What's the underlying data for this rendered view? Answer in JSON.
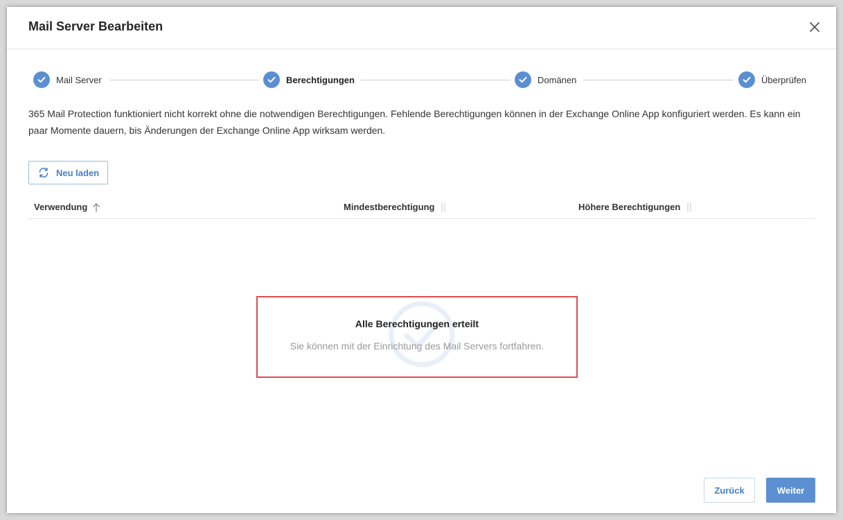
{
  "dialog": {
    "title": "Mail Server Bearbeiten",
    "close_icon": "close-icon"
  },
  "stepper": {
    "steps": [
      {
        "label": "Mail Server",
        "state": "done",
        "active": false
      },
      {
        "label": "Berechtigungen",
        "state": "done",
        "active": true
      },
      {
        "label": "Domänen",
        "state": "done",
        "active": false
      },
      {
        "label": "Überprüfen",
        "state": "done",
        "active": false
      }
    ]
  },
  "description": "365 Mail Protection funktioniert nicht korrekt ohne die notwendigen Berechtigungen. Fehlende Berechtigungen können in der Exchange Online App konfiguriert werden. Es kann ein paar Momente dauern, bis Änderungen der Exchange Online App wirksam werden.",
  "reload_button": {
    "label": "Neu laden",
    "icon": "refresh-icon"
  },
  "table": {
    "columns": [
      {
        "label": "Verwendung",
        "sort": "ascending"
      },
      {
        "label": "Mindestberechtigung",
        "sort": "none"
      },
      {
        "label": "Höhere Berechtigungen",
        "sort": "none"
      }
    ]
  },
  "empty_state": {
    "title": "Alle Berechtigungen erteilt",
    "subtitle": "Sie können mit der Einrichtung des Mail Servers fortfahren.",
    "icon": "check-circle-icon"
  },
  "footer": {
    "back_label": "Zurück",
    "next_label": "Weiter"
  },
  "colors": {
    "accent": "#5b8fd1",
    "highlight_border": "#e04a4f"
  }
}
